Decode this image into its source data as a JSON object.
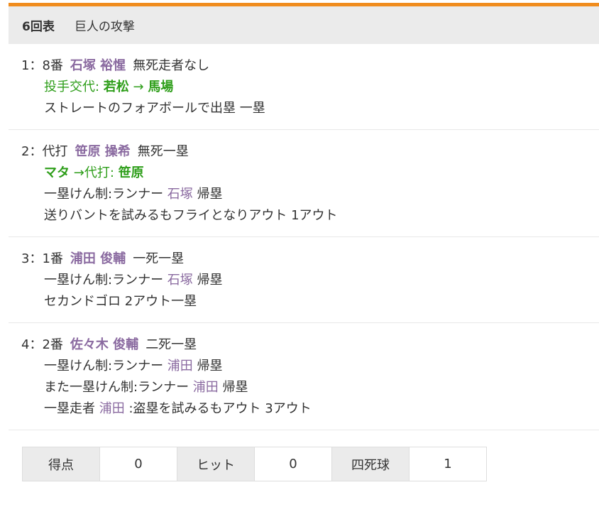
{
  "header": {
    "inning": "6回表",
    "team_attack": "巨人の攻撃"
  },
  "plays": [
    {
      "no": "1：8番",
      "batter": "石塚 裕惺",
      "situation": "無死走者なし",
      "sub_prefix": "投手交代: ",
      "sub_from": "若松",
      "sub_arrow": "→",
      "sub_to": "馬場",
      "result": "ストレートのフォアボールで出塁 一塁"
    },
    {
      "no": "2：代打",
      "batter": "笹原 操希",
      "situation": "無死一塁",
      "sub_from": "マタ",
      "sub_arrow": "→代打: ",
      "sub_to": "笹原",
      "check_prefix": "一塁けん制:ランナー ",
      "check_runner": "石塚",
      "check_suffix": "帰塁",
      "result": "送りバントを試みるもフライとなりアウト 1アウト"
    },
    {
      "no": "3：1番",
      "batter": "浦田 俊輔",
      "situation": "一死一塁",
      "check_prefix": "一塁けん制:ランナー ",
      "check_runner": "石塚",
      "check_suffix": "帰塁",
      "result": "セカンドゴロ 2アウト一塁"
    },
    {
      "no": "4：2番",
      "batter": "佐々木 俊輔",
      "situation": "二死一塁",
      "check1_prefix": "一塁けん制:ランナー ",
      "check1_runner": "浦田",
      "check1_suffix": "帰塁",
      "check2_prefix": "また一塁けん制:ランナー ",
      "check2_runner": "浦田",
      "check2_suffix": "帰塁",
      "steal_prefix": "一塁走者 ",
      "steal_runner": "浦田",
      "steal_suffix": ":盗塁を試みるもアウト 3アウト"
    }
  ],
  "summary": {
    "runs_label": "得点",
    "runs": "0",
    "hits_label": "ヒット",
    "hits": "0",
    "walks_label": "四死球",
    "walks": "1"
  },
  "colors": {
    "accent": "#f08c1e",
    "player": "#8a6aa0",
    "substitution": "#2e9e1a",
    "header_bg": "#ebebeb"
  }
}
